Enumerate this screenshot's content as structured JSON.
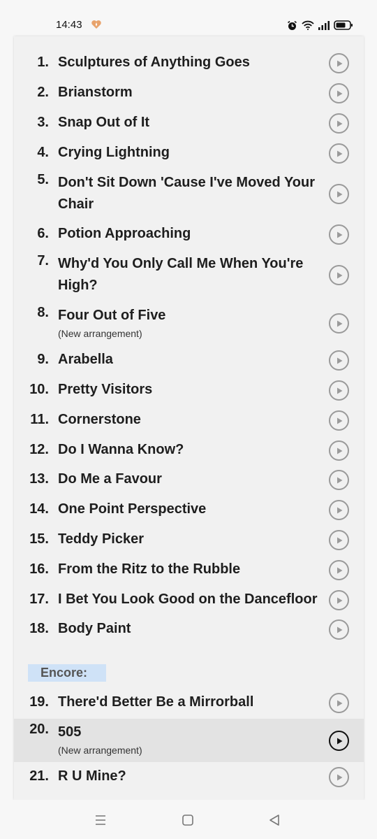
{
  "status": {
    "time": "14:43",
    "icons": [
      "heart-badge-icon",
      "alarm-icon",
      "wifi-icon",
      "signal-icon",
      "battery-icon"
    ]
  },
  "setlist": [
    {
      "num": "1.",
      "title": "Sculptures of Anything Goes"
    },
    {
      "num": "2.",
      "title": "Brianstorm"
    },
    {
      "num": "3.",
      "title": "Snap Out of It"
    },
    {
      "num": "4.",
      "title": "Crying Lightning"
    },
    {
      "num": "5.",
      "title": "Don't Sit Down 'Cause I've Moved Your Chair"
    },
    {
      "num": "6.",
      "title": "Potion Approaching"
    },
    {
      "num": "7.",
      "title": "Why'd You Only Call Me When You're High?"
    },
    {
      "num": "8.",
      "title": "Four Out of Five",
      "note": "(New arrangement)"
    },
    {
      "num": "9.",
      "title": "Arabella"
    },
    {
      "num": "10.",
      "title": "Pretty Visitors"
    },
    {
      "num": "11.",
      "title": "Cornerstone"
    },
    {
      "num": "12.",
      "title": "Do I Wanna Know?"
    },
    {
      "num": "13.",
      "title": "Do Me a Favour"
    },
    {
      "num": "14.",
      "title": "One Point Perspective"
    },
    {
      "num": "15.",
      "title": "Teddy Picker"
    },
    {
      "num": "16.",
      "title": "From the Ritz to the Rubble"
    },
    {
      "num": "17.",
      "title": "I Bet You Look Good on the Dancefloor"
    },
    {
      "num": "18.",
      "title": "Body Paint"
    }
  ],
  "encore_label": "Encore:",
  "encore": [
    {
      "num": "19.",
      "title": "There'd Better Be a Mirrorball"
    },
    {
      "num": "20.",
      "title": "505",
      "note": "(New arrangement)",
      "active": true
    },
    {
      "num": "21.",
      "title": "R U Mine?"
    }
  ],
  "nav": [
    "menu-icon",
    "home-icon",
    "back-icon"
  ]
}
